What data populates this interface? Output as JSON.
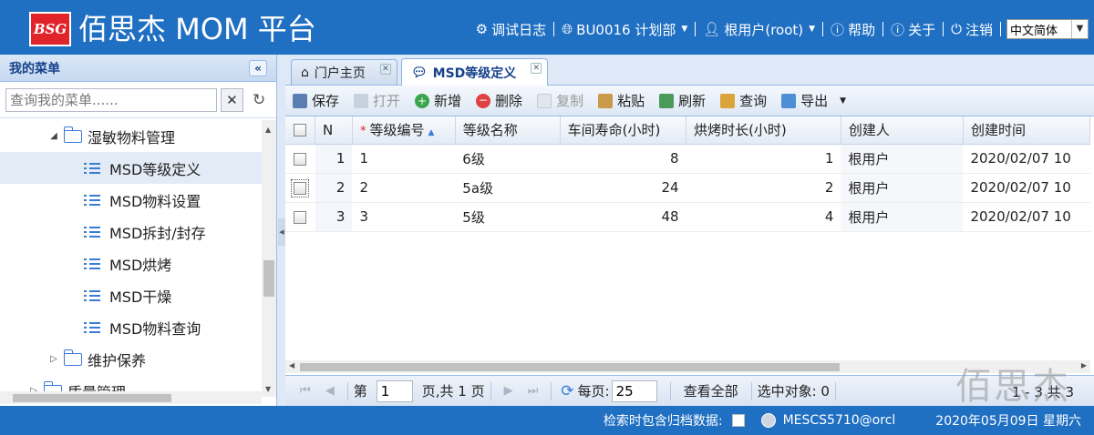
{
  "app": {
    "logo": "BSG",
    "title": "佰思杰 MOM 平台"
  },
  "topnav": {
    "debug_log": "调试日志",
    "department": "BU0016 计划部",
    "user": "根用户(root)",
    "help": "帮助",
    "about": "关于",
    "logout": "注销",
    "language": "中文简体"
  },
  "sidebar": {
    "title": "我的菜单",
    "search_placeholder": "查询我的菜单......",
    "tree": [
      {
        "label": "湿敏物料管理",
        "type": "folder",
        "expanded": true
      },
      {
        "label": "MSD等级定义",
        "type": "leaf",
        "selected": true
      },
      {
        "label": "MSD物料设置",
        "type": "leaf"
      },
      {
        "label": "MSD拆封/封存",
        "type": "leaf"
      },
      {
        "label": "MSD烘烤",
        "type": "leaf"
      },
      {
        "label": "MSD干燥",
        "type": "leaf"
      },
      {
        "label": "MSD物料查询",
        "type": "leaf"
      },
      {
        "label": "维护保养",
        "type": "folder",
        "expanded": false
      },
      {
        "label": "质量管理",
        "type": "folder",
        "expanded": false
      }
    ]
  },
  "tabs": [
    {
      "label": "门户主页",
      "active": false
    },
    {
      "label": "MSD等级定义",
      "active": true
    }
  ],
  "toolbar": {
    "save": "保存",
    "open": "打开",
    "add": "新增",
    "delete": "删除",
    "copy": "复制",
    "paste": "粘贴",
    "refresh": "刷新",
    "query": "查询",
    "export": "导出"
  },
  "grid": {
    "columns": [
      "N",
      "等级编号",
      "等级名称",
      "车间寿命(小时)",
      "烘烤时长(小时)",
      "创建人",
      "创建时间"
    ],
    "rows": [
      {
        "n": "1",
        "code": "1",
        "name": "6级",
        "life": "8",
        "bake": "1",
        "creator": "根用户",
        "created": "2020/02/07 10"
      },
      {
        "n": "2",
        "code": "2",
        "name": "5a级",
        "life": "24",
        "bake": "2",
        "creator": "根用户",
        "created": "2020/02/07 10"
      },
      {
        "n": "3",
        "code": "3",
        "name": "5级",
        "life": "48",
        "bake": "4",
        "creator": "根用户",
        "created": "2020/02/07 10"
      }
    ]
  },
  "pager": {
    "page_label": "第",
    "page_value": "1",
    "page_total": "页,共 1 页",
    "per_page_label": "每页:",
    "per_page_value": "25",
    "show_all": "查看全部",
    "selected_label": "选中对象: 0",
    "count": "1 - 3 共 3"
  },
  "watermark": "佰思杰",
  "status": {
    "archive_label": "检索时包含归档数据:",
    "db": "MESCS5710@orcl",
    "date": "2020年05月09日 星期六"
  },
  "colors": {
    "header_blue": "#1f6fc2",
    "logo_red": "#e0242a",
    "panel_border": "#99bbe8"
  }
}
